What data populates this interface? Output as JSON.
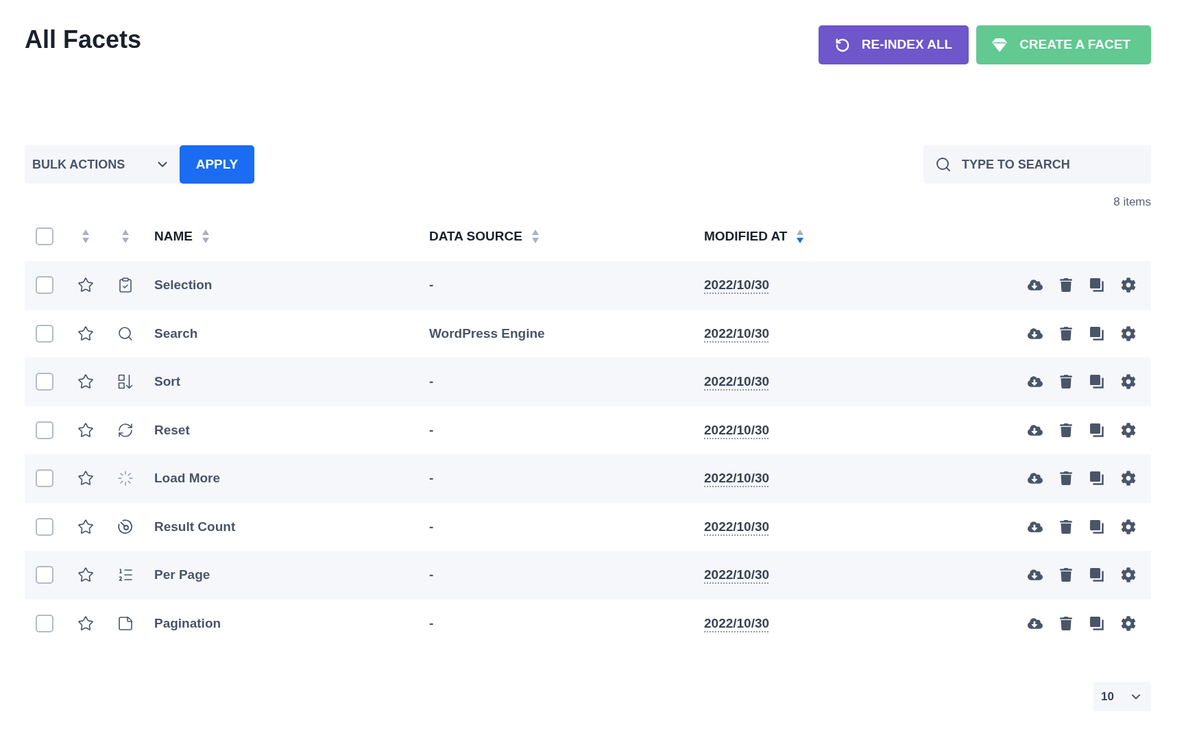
{
  "page": {
    "title": "All Facets"
  },
  "header_buttons": [
    {
      "kind": "reindex",
      "label": "RE-INDEX ALL"
    },
    {
      "kind": "create",
      "label": "CREATE A FACET"
    }
  ],
  "toolbar": {
    "bulk_actions": {
      "value": "BULK ACTIONS"
    },
    "apply_button": {
      "label": "APPLY"
    },
    "search": {
      "placeholder": "TYPE TO SEARCH"
    }
  },
  "item_count": "8 items",
  "table": {
    "columns": [
      {
        "kind": "select",
        "checked": false
      },
      {
        "kind": "sort",
        "sort_descending": false
      },
      {
        "kind": "sort",
        "sort_descending": false
      },
      {
        "kind": "text",
        "label": "NAME",
        "sort_descending": false
      },
      {
        "kind": "text",
        "label": "DATA SOURCE",
        "sort_descending": false
      },
      {
        "kind": "text",
        "label": "MODIFIED AT",
        "sort_descending": true
      }
    ],
    "rows": [
      {
        "checked": false,
        "starred": false,
        "kind": "selection",
        "name": "Selection",
        "data_source": "-",
        "modified_at": "2022/10/30"
      },
      {
        "checked": false,
        "starred": false,
        "kind": "search",
        "name": "Search",
        "data_source": "WordPress Engine",
        "modified_at": "2022/10/30"
      },
      {
        "checked": false,
        "starred": false,
        "kind": "sort",
        "name": "Sort",
        "data_source": "-",
        "modified_at": "2022/10/30"
      },
      {
        "checked": false,
        "starred": false,
        "kind": "reset",
        "name": "Reset",
        "data_source": "-",
        "modified_at": "2022/10/30"
      },
      {
        "checked": false,
        "starred": false,
        "kind": "load_more",
        "name": "Load More",
        "data_source": "-",
        "modified_at": "2022/10/30"
      },
      {
        "checked": false,
        "starred": false,
        "kind": "result_count",
        "name": "Result Count",
        "data_source": "-",
        "modified_at": "2022/10/30"
      },
      {
        "checked": false,
        "starred": false,
        "kind": "per_page",
        "name": "Per Page",
        "data_source": "-",
        "modified_at": "2022/10/30"
      },
      {
        "checked": false,
        "starred": false,
        "kind": "pagination",
        "name": "Pagination",
        "data_source": "-",
        "modified_at": "2022/10/30"
      }
    ]
  },
  "pagination": {
    "per_page": "10"
  }
}
